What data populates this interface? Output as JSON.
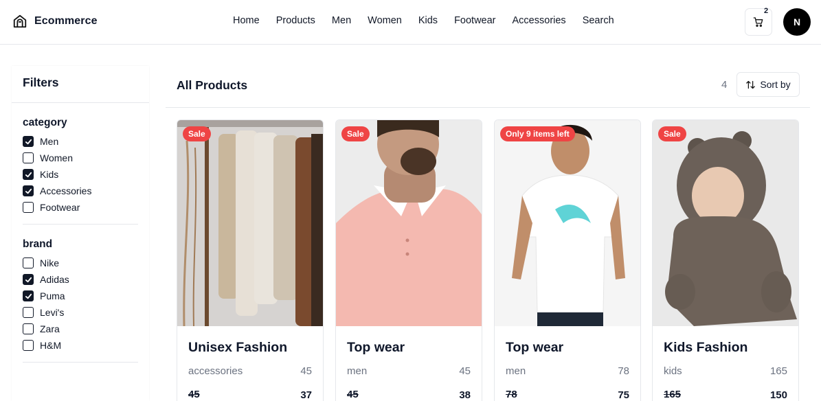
{
  "header": {
    "brand": "Ecommerce",
    "nav": [
      "Home",
      "Products",
      "Men",
      "Women",
      "Kids",
      "Footwear",
      "Accessories",
      "Search"
    ],
    "cart_count": "2",
    "avatar_initial": "N"
  },
  "filters": {
    "title": "Filters",
    "category": {
      "title": "category",
      "options": [
        {
          "label": "Men",
          "checked": true
        },
        {
          "label": "Women",
          "checked": false
        },
        {
          "label": "Kids",
          "checked": true
        },
        {
          "label": "Accessories",
          "checked": true
        },
        {
          "label": "Footwear",
          "checked": false
        }
      ]
    },
    "brand": {
      "title": "brand",
      "options": [
        {
          "label": "Nike",
          "checked": false
        },
        {
          "label": "Adidas",
          "checked": true
        },
        {
          "label": "Puma",
          "checked": true
        },
        {
          "label": "Levi's",
          "checked": false
        },
        {
          "label": "Zara",
          "checked": false
        },
        {
          "label": "H&M",
          "checked": false
        }
      ]
    }
  },
  "main": {
    "title": "All Products",
    "count": "4",
    "sort_label": "Sort by"
  },
  "products": [
    {
      "badge": "Sale",
      "title": "Unisex Fashion",
      "category": "accessories",
      "stock": "45",
      "price": "45",
      "sale_price": "37",
      "image": "clothes-rack"
    },
    {
      "badge": "Sale",
      "title": "Top wear",
      "category": "men",
      "stock": "45",
      "price": "45",
      "sale_price": "38",
      "image": "pink-polo-man"
    },
    {
      "badge": "Only 9 items left",
      "title": "Top wear",
      "category": "men",
      "stock": "78",
      "price": "78",
      "sale_price": "75",
      "image": "white-tee-man"
    },
    {
      "badge": "Sale",
      "title": "Kids Fashion",
      "category": "kids",
      "stock": "165",
      "price": "165",
      "sale_price": "150",
      "image": "baby-fleece"
    }
  ],
  "colors": {
    "accent": "#0f172a",
    "badge": "#ef4444",
    "muted": "#6b7280",
    "border": "#e5e7eb"
  }
}
